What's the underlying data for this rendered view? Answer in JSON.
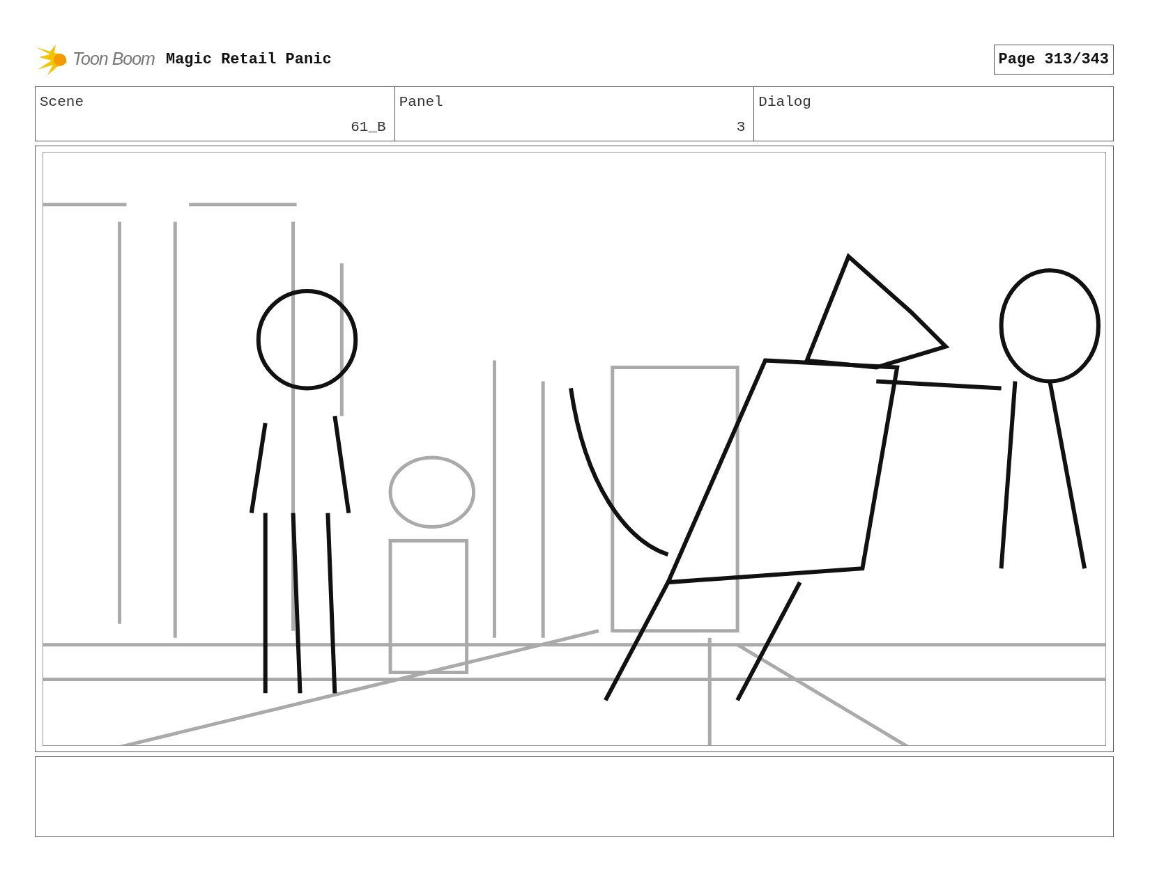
{
  "header": {
    "logo_text": "Toon Boom",
    "title": "Magic Retail Panic",
    "page": "Page 313/343"
  },
  "fields": [
    {
      "label": "Scene",
      "value": "61_B"
    },
    {
      "label": "Panel",
      "value": "3"
    },
    {
      "label": "Dialog"
    }
  ]
}
